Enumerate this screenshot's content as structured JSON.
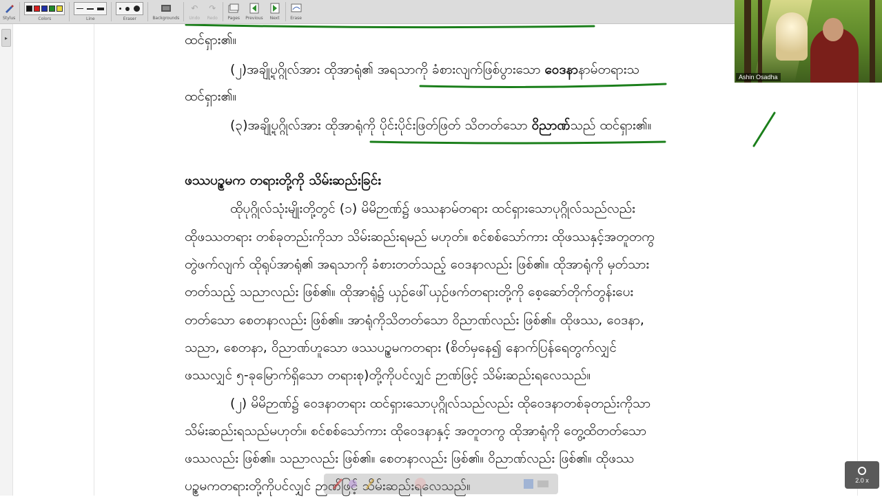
{
  "toolbar": {
    "groups": [
      {
        "name": "Stylus"
      },
      {
        "name": "Colors",
        "colors": [
          "#111111",
          "#d81e1e",
          "#1f2fa8",
          "#1f8a2a",
          "#e8d83a"
        ]
      },
      {
        "name": "Line"
      },
      {
        "name": "Eraser"
      },
      {
        "name": "Backgrounds"
      },
      {
        "name": "Undo"
      },
      {
        "name": "Redo"
      },
      {
        "name": "Pages"
      },
      {
        "name": "Previous"
      },
      {
        "name": "Next"
      },
      {
        "name": "Erase"
      }
    ]
  },
  "document": {
    "line1": "ထင်ရှား၏။",
    "item2_prefix": "(၂)အချို့ပုဂ္ဂိုလ်အား ထိုအာရုံ၏ အရသာကို ခံစားလျက်ဖြစ်ပွားသော ",
    "item2_bold": "ဝေဒနာ",
    "item2_suffix": "နာမ်တရားသ",
    "line3": "ထင်ရှား၏။",
    "item3_prefix": "(၃)အချို့ပုဂ္ဂိုလ်အား ထိုအာရုံကို ပိုင်းပိုင်းဖြတ်ဖြတ် သိတတ်သော ",
    "item3_bold": "ဝိညာဏ်",
    "item3_suffix": "သည် ထင်ရှား၏။",
    "heading": "ဖဿပဉ္စမက တရားတို့ကို သိမ်းဆည်းခြင်း",
    "p1": "ထိုပုဂ္ဂိုလ်သုံးမျိုးတို့တွင် (၁) မိမိဉာဏ်၌ ဖဿနာမ်တရား ထင်ရှားသောပုဂ္ဂိုလ်သည်လည်း",
    "p2": "ထိုဖဿတရား တစ်ခုတည်းကိုသာ သိမ်းဆည်းရမည် မဟုတ်။ စင်စစ်သော်ကား ထိုဖဿနှင့်အတူတကွ",
    "p3": "တွဲဖက်လျက် ထိုရုပ်အာရုံ၏ အရသာကို ခံစားတတ်သည့် ဝေဒနာလည်း ဖြစ်၏။ ထိုအာရုံကို မှတ်သား",
    "p4": "တတ်သည့် သညာလည်း ဖြစ်၏။ ထိုအာရုံ၌ ယှဉ်ဖေါ်ယှဉ်ဖက်တရားတို့ကို စေ့ဆော်တိုက်တွန်းပေး",
    "p5": "တတ်သော စေတနာလည်း ဖြစ်၏။ အာရုံကိုသိတတ်သော ဝိညာဏ်လည်း ဖြစ်၏။ ထိုဖဿ, ဝေဒနာ,",
    "p6": "သညာ, စေတနာ, ဝိညာဏ်ဟူသော ဖဿပဉ္စမကတရား (စိတ်မှနေ၍ နောက်ပြန်ရေတွက်လျှင်",
    "p7": "ဖဿလျှင် ၅-ခုမြောက်ရှိသော တရားစု)တို့ကိုပင်လျှင် ဉာဏ်ဖြင့် သိမ်းဆည်းရလေသည်။",
    "p8": "(၂) မိမိဉာဏ်၌ ဝေဒနာတရား ထင်ရှားသောပုဂ္ဂိုလ်သည်လည်း ထိုဝေဒနာတစ်ခုတည်းကိုသာ",
    "p9": "သိမ်းဆည်းရသည်မဟုတ်။ စင်စစ်သော်ကား ထိုဝေဒနာနှင့် အတူတကွ ထိုအာရုံကို တွေ့ထိတတ်သော",
    "p10": "ဖဿလည်း ဖြစ်၏။ သညာလည်း ဖြစ်၏။ စေတနာလည်း ဖြစ်၏။ ဝိညာဏ်လည်း ဖြစ်၏။ ထိုဖဿ",
    "p11": "ပဉ္စမကတရားတို့ကိုပင်လျှင် ဉာဏ်ဖြင့် သိမ်းဆည်းရလေသည်။"
  },
  "video": {
    "participant_name": "Ashin Osadha"
  },
  "zoom": {
    "level": "2.0 x"
  },
  "colors": {
    "pen_green": "#1b7f1b"
  }
}
